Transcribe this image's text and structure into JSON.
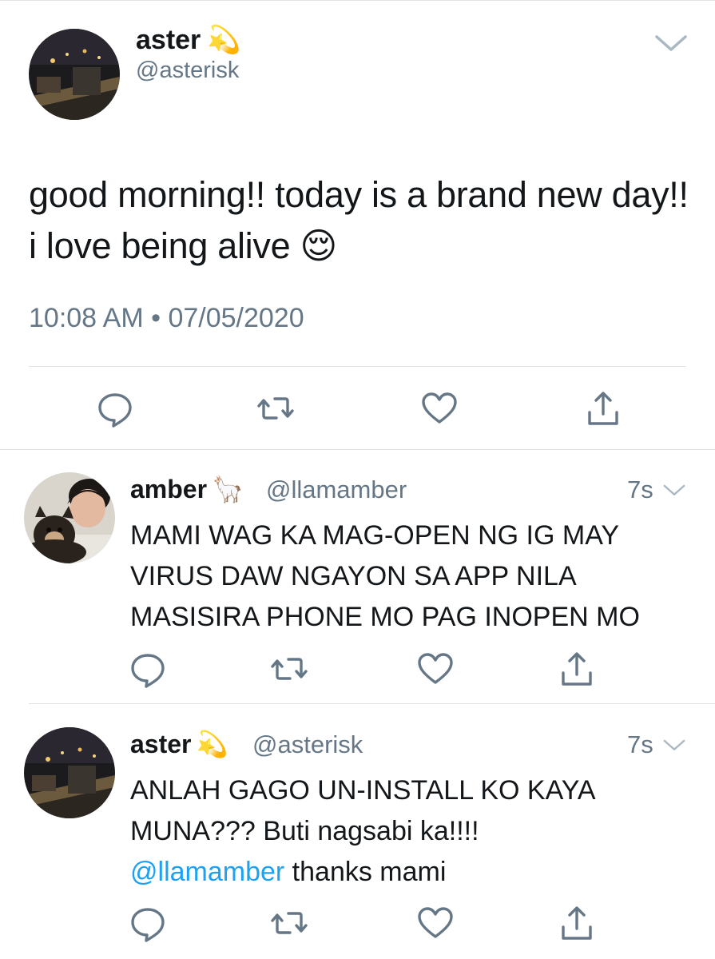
{
  "main_tweet": {
    "display_name": "aster",
    "name_emoji": "💫",
    "handle": "@asterisk",
    "text": "good morning!! today is a brand new day!! i love being alive 😌",
    "timestamp": "10:08 AM • 07/05/2020",
    "actions": [
      "reply-icon",
      "retweet-icon",
      "like-icon",
      "share-icon"
    ]
  },
  "replies": [
    {
      "display_name": "amber",
      "name_emoji": "🦙",
      "handle": "@llamamber",
      "time": "7s",
      "text": "MAMI WAG KA MAG-OPEN NG IG MAY VIRUS DAW NGAYON SA APP NILA MASISIRA PHONE MO PAG INOPEN MO"
    },
    {
      "display_name": "aster",
      "name_emoji": "💫",
      "handle": "@asterisk",
      "time": "7s",
      "text_before": "ANLAH GAGO UN-INSTALL KO KAYA MUNA??? Buti nagsabi ka!!!!",
      "mention": "@llamamber",
      "text_after": " thanks mami"
    }
  ],
  "colors": {
    "accent": "#1da1f2",
    "secondary_text": "#657786",
    "icon": "#657786",
    "divider": "#dfe3e6"
  }
}
